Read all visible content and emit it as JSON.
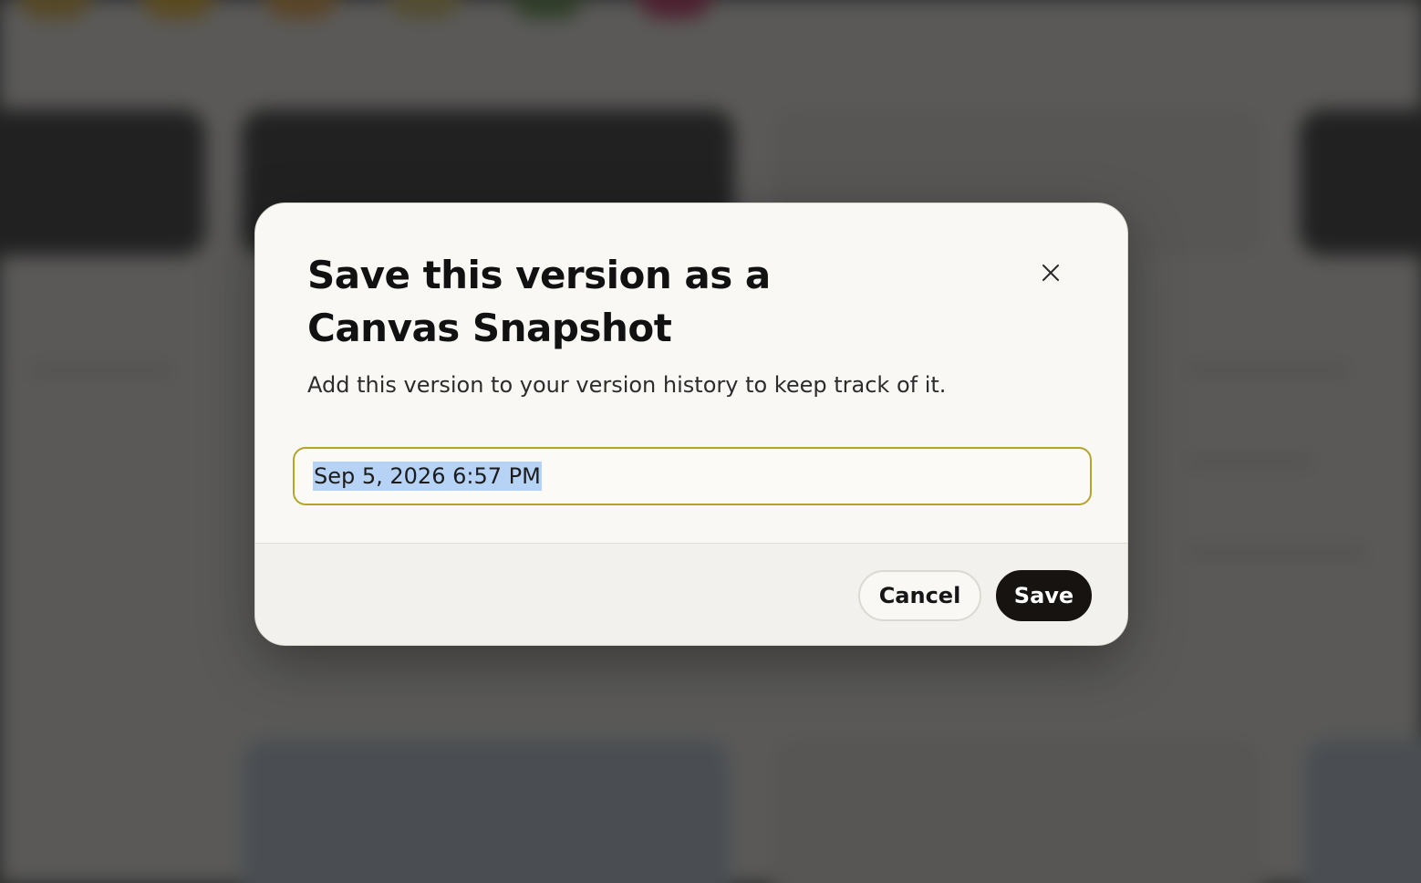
{
  "dialog": {
    "title": "Save this version as a Canvas Snapshot",
    "description": "Add this version to your version history to keep track of it.",
    "name_value": "Sep 5, 2026 6:57 PM",
    "close_icon": "close-icon",
    "cancel_label": "Cancel",
    "save_label": "Save"
  },
  "colors": {
    "dialog_background": "#f9f8f5",
    "input_border_focus": "#b3a52a",
    "selection_highlight": "#b6d3f6",
    "primary_button": "#171310",
    "overlay": "#1e1e1e"
  }
}
